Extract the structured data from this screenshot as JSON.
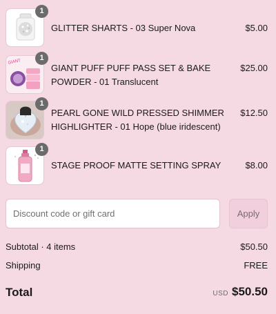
{
  "cart": {
    "items": [
      {
        "name": "GLITTER SHARTS - 03 Super Nova",
        "price": "$5.00",
        "quantity": "1",
        "thumbnail_icon": "glitter-jar-icon"
      },
      {
        "name": "GIANT PUFF PUFF PASS SET & BAKE POWDER - 01 Translucent",
        "price": "$25.00",
        "quantity": "1",
        "thumbnail_icon": "powder-set-icon"
      },
      {
        "name": "PEARL GONE WILD PRESSED SHIMMER HIGHLIGHTER - 01 Hope (blue iridescent)",
        "price": "$12.50",
        "quantity": "1",
        "thumbnail_icon": "heart-highlighter-icon"
      },
      {
        "name": "STAGE PROOF MATTE SETTING SPRAY",
        "price": "$8.00",
        "quantity": "1",
        "thumbnail_icon": "spray-bottle-icon"
      }
    ]
  },
  "discount": {
    "placeholder": "Discount code or gift card",
    "apply_label": "Apply"
  },
  "summary": {
    "subtotal_label": "Subtotal · 4 items",
    "subtotal_value": "$50.50",
    "shipping_label": "Shipping",
    "shipping_value": "FREE",
    "total_label": "Total",
    "currency": "USD",
    "total_value": "$50.50"
  },
  "colors": {
    "background": "#f5d9e3",
    "badge": "#6b6b6b",
    "apply_button": "#f1cfdc"
  }
}
